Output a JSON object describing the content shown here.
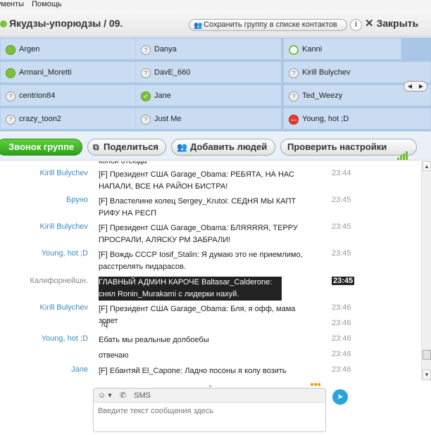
{
  "menubar": {
    "items": [
      "ументы",
      "Помощь"
    ]
  },
  "header": {
    "title": "Якудзы-упорюдзы / 09.",
    "save_group": "Сохранить группу в списке контактов",
    "info": "i",
    "close": "Закрыть"
  },
  "participants": [
    {
      "name": "Argen",
      "status": "online"
    },
    {
      "name": "Danya",
      "status": "offline"
    },
    {
      "name": "Kanni",
      "status": "green-outline"
    },
    {
      "name": "Armani_Moretti",
      "status": "online"
    },
    {
      "name": "DavE_660",
      "status": "offline"
    },
    {
      "name": "Kirill Bulychev",
      "status": "offline"
    },
    {
      "name": "centrion84",
      "status": "offline"
    },
    {
      "name": "Jane",
      "status": "online"
    },
    {
      "name": "Ted_Weezy",
      "status": "offline"
    },
    {
      "name": "crazy_toon2",
      "status": "offline"
    },
    {
      "name": "Just Me",
      "status": "offline"
    },
    {
      "name": "Young, hot ;D",
      "status": "busy"
    }
  ],
  "toolbar": {
    "call_group": "Звонок группе",
    "share": "Поделиться",
    "add_people": "Добавить людей",
    "check_settings": "Проверить настройки"
  },
  "chat": {
    "partial_top": "копси отсюда",
    "messages": [
      {
        "sender": "Kirill Bulychev",
        "text": "[F] Президент США Garage_Obama: РЕБЯТА, НА НАС НАПАЛИ, ВСЕ НА РАЙОН БИСТРА!",
        "time": "23:44"
      },
      {
        "sender": "Бруно",
        "text": "[F] Властелине колец Sergey_Krutoi: СЕДНЯ МЫ КАПТ РИФУ НА РЕСП",
        "time": "23:45"
      },
      {
        "sender": "Kirill Bulychev",
        "text": "[F] Президент США Garage_Obama: БЛЯЯЯЯЯ, ТЕРРУ ПРОСРАЛИ, АЛЯСКУ РМ ЗАБРАЛИ!",
        "time": "23:45"
      },
      {
        "sender": "Young, hot ;D",
        "text": "[F] Вождь СССР Iosif_Stalin: Я думаю это не приемлимо, расстрелять пидарасов.",
        "time": "23:45"
      },
      {
        "sender": "Калифорнейшн.",
        "text": "ГЛАВНЫЙ АДМИН КАРОЧЕ Baltasar_Calderone: снял Ronin_Murakami с лидерки нахуй.",
        "time": "23:45"
      },
      {
        "sender": "Kirill Bulychev",
        "text": "[F] Президент США Garage_Obama: Бля, я офф, мама зовет",
        "time": "23:46"
      },
      {
        "sender": "",
        "text": "/q",
        "time": "23:46"
      },
      {
        "sender": "Young, hot ;D",
        "text": "Ебать мы реальные долбоебы",
        "time": "23:46"
      },
      {
        "sender": "",
        "text": "отвечаю",
        "time": "23:46"
      },
      {
        "sender": "Jane",
        "text": "[F] Ебантяй El_Capone: Ладно посоны я колу возить",
        "time": "23:46"
      }
    ]
  },
  "composer": {
    "emoji_label": "☺ ▾",
    "sms_label": "SMS",
    "placeholder": "Введите текст сообщения здесь"
  },
  "colors": {
    "accent": "#3a8cc8",
    "call_button": "#3bb520",
    "participants_bg": "#c9dcf2",
    "highlight_bg": "#222222"
  }
}
